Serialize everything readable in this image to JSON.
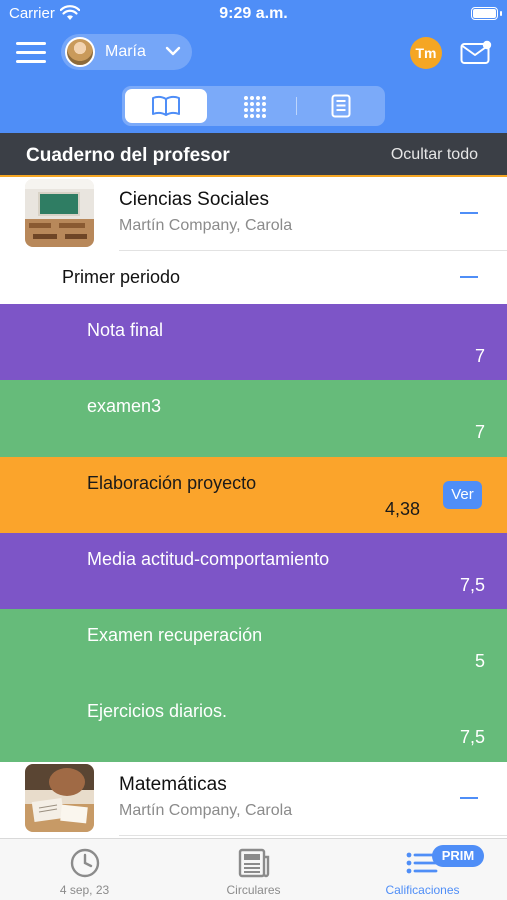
{
  "status_bar": {
    "carrier": "Carrier",
    "time": "9:29 a.m."
  },
  "header": {
    "user_name": "María",
    "tm_badge": "Tm",
    "view_modes": [
      "book-icon",
      "grid-icon",
      "document-icon"
    ],
    "active_view": "book-icon"
  },
  "section": {
    "title": "Cuaderno del profesor",
    "hide_all": "Ocultar todo"
  },
  "subjects": [
    {
      "name": "Ciencias Sociales",
      "teacher": "Martín Company, Carola",
      "expanded": true
    },
    {
      "name": "Matemáticas",
      "teacher": "Martín Company, Carola",
      "expanded": true
    }
  ],
  "period": {
    "label": "Primer periodo"
  },
  "grades": [
    {
      "name": "Nota final",
      "value": "7",
      "color": "#7d55c7"
    },
    {
      "name": "examen3",
      "value": "7",
      "color": "#66bb7a"
    },
    {
      "name": "Elaboración proyecto",
      "value": "4,38",
      "color": "#fba42b",
      "action": "Ver"
    },
    {
      "name": "Media actitud-comportamiento",
      "value": "7,5",
      "color": "#7d55c7"
    },
    {
      "name": "Examen recuperación",
      "value": "5",
      "color": "#66bb7a"
    },
    {
      "name": "Ejercicios diarios.",
      "value": "7,5",
      "color": "#66bb7a"
    }
  ],
  "tabbar": {
    "tabs": [
      {
        "label": "4 sep, 23",
        "icon": "clock-icon"
      },
      {
        "label": "Circulares",
        "icon": "newspaper-icon"
      },
      {
        "label": "Calificaciones",
        "icon": "grades-list-icon"
      }
    ],
    "active": "Calificaciones",
    "badge": "PRIM"
  },
  "colors": {
    "accent": "#4f8ef7",
    "header_dark": "#3b3f46",
    "purple": "#7d55c7",
    "green": "#66bb7a",
    "orange": "#fba42b"
  }
}
